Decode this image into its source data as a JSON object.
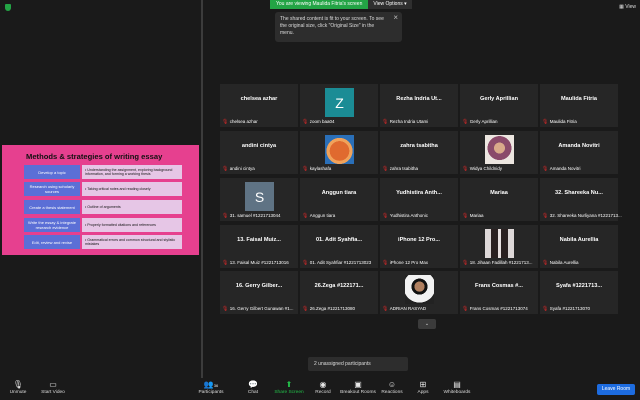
{
  "banner": {
    "viewing": "You are viewing Maulida Fitria's screen",
    "options": "View Options ▾",
    "view_btn": "▦ View"
  },
  "tooltip": {
    "text": "The shared content is fit to your screen. To see the original size, click \"Original Size\" in the menu."
  },
  "slide": {
    "title": "Methods & strategies of writing essay",
    "rows": [
      {
        "left": "Develop a topic",
        "right": "• Understanding the assignment, exploring background information, and forming a working thesis"
      },
      {
        "left": "Research using scholarly sources",
        "right": "• Taking critical notes and reading closely"
      },
      {
        "left": "Create a thesis statement",
        "right": "• Outline of arguments"
      },
      {
        "left": "Write the essay & integrate research evidence",
        "right": "• Properly formatted citations and references"
      },
      {
        "left": "Edit, review and revise",
        "right": "• Grammatical errors and common structural and stylistic mistakes"
      }
    ]
  },
  "tiles": [
    {
      "name": "chelsea azhar",
      "label": "chelsea azhar",
      "avatar": ""
    },
    {
      "name": "",
      "label": "zoom baa04",
      "avatar": "Z"
    },
    {
      "name": "Rezha Indria Ut...",
      "label": "Rezha Indria Utami",
      "avatar": ""
    },
    {
      "name": "Gerly Aprillian",
      "label": "Gerly Aprillian",
      "avatar": ""
    },
    {
      "name": "Maulida Fitria",
      "label": "Maulida Fitria",
      "avatar": ""
    },
    {
      "name": "andini cintya",
      "label": "andini cintya",
      "avatar": ""
    },
    {
      "name": "",
      "label": "kaylashafa",
      "avatar": "cartoon-face"
    },
    {
      "name": "zahra tsabitha",
      "label": "zahra tsabitha",
      "avatar": ""
    },
    {
      "name": "",
      "label": "Widya Childnidy",
      "avatar": "hijab-photo"
    },
    {
      "name": "Amanda Novitri",
      "label": "Amanda Novitri",
      "avatar": ""
    },
    {
      "name": "",
      "label": "31. samuel #1221713044",
      "avatar": "S"
    },
    {
      "name": "Anggun tiara",
      "label": "Anggun tiara",
      "avatar": ""
    },
    {
      "name": "Yudhistira Anth...",
      "label": "Yudhistira Anthonic",
      "avatar": ""
    },
    {
      "name": "Mariaa",
      "label": "Mariaa",
      "avatar": ""
    },
    {
      "name": "32. Shareeka Nu...",
      "label": "32. Shareeka Nurliyana #1221713...",
      "avatar": ""
    },
    {
      "name": "13. Faisal Muiz...",
      "label": "13. Faisal Muiz #1221713016",
      "avatar": ""
    },
    {
      "name": "01. Adit Syahfia...",
      "label": "01. Adit Syahfiar #1221713023",
      "avatar": ""
    },
    {
      "name": "iPhone 12 Pro...",
      "label": "iPhone 12 Pro Max",
      "avatar": ""
    },
    {
      "name": "",
      "label": "18. Jihaan Fadillah #1221713...",
      "avatar": "two-photo"
    },
    {
      "name": "Nabila Aurellia",
      "label": "Nabila Aurellia",
      "avatar": ""
    },
    {
      "name": "16. Gerry Gilber...",
      "label": "16. Gerry Gilbert Gunawan #1...",
      "avatar": ""
    },
    {
      "name": "26.Zega #122171...",
      "label": "26.Zega #1221713080",
      "avatar": ""
    },
    {
      "name": "",
      "label": "ADRIAN RASYAD",
      "avatar": "man-photo"
    },
    {
      "name": "Frans Cosmas #...",
      "label": "Frans Cosmas #1221713074",
      "avatar": ""
    },
    {
      "name": "Syafa #1221713...",
      "label": "Syafa #1221713070",
      "avatar": ""
    }
  ],
  "gallery": {
    "chevron": "⌄",
    "unassigned": "2 unassigned participants"
  },
  "toolbar": {
    "unmute": "Unmute",
    "start_video": "Start Video",
    "participants": "Participants",
    "participants_count": "36",
    "chat": "Chat",
    "share": "Share Screen",
    "record": "Record",
    "breakout": "Breakout Rooms",
    "reactions": "Reactions",
    "apps": "Apps",
    "whiteboards": "Whiteboards",
    "leave": "Leave Room"
  },
  "colors": {
    "accent_green": "#23a445",
    "leave_blue": "#1d6ce0",
    "slide_pink": "#e6408f",
    "muted_red": "#e02828"
  }
}
